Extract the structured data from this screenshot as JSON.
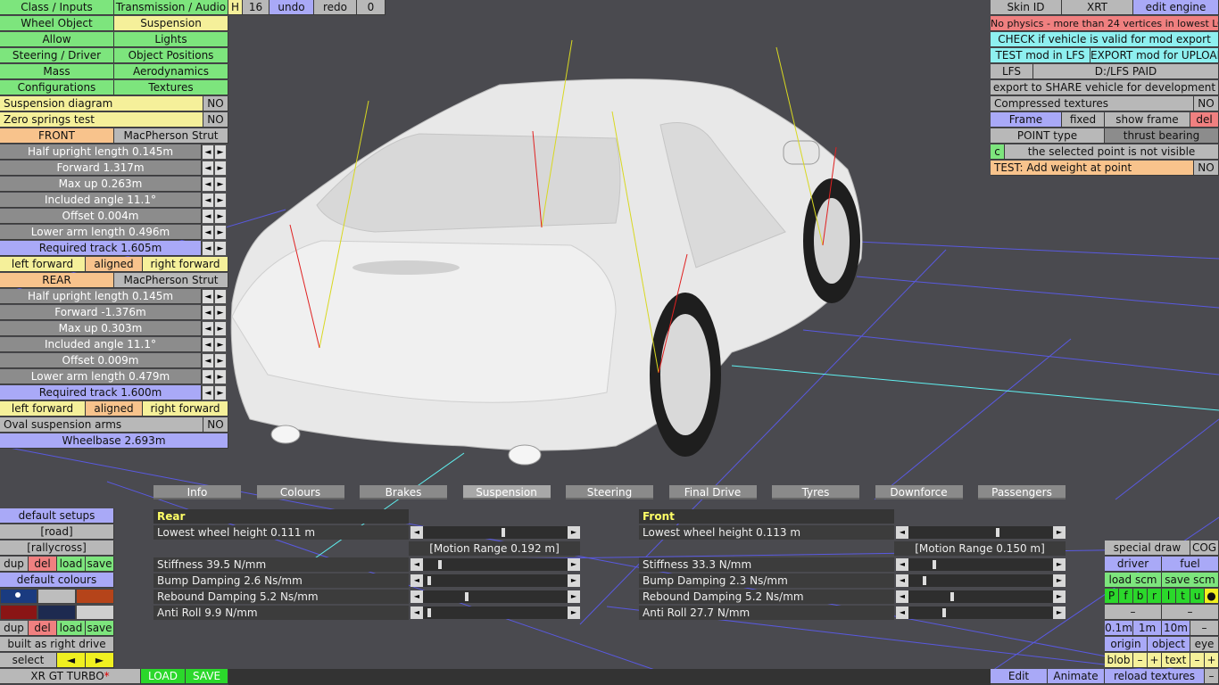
{
  "colors": {
    "green": "#7de57d",
    "yellow": "#f5f09a",
    "orange": "#f8c38c",
    "purple": "#a9a9f7",
    "cyan": "#8ef0f0",
    "red": "#f08080"
  },
  "left": {
    "class_inputs": "Class / Inputs",
    "transmission_audio": "Transmission / Audio",
    "h": "H",
    "num16": "16",
    "undo": "undo",
    "redo": "redo",
    "zero": "0",
    "wheel_object": "Wheel Object",
    "suspension": "Suspension",
    "allow": "Allow",
    "lights": "Lights",
    "steering_driver": "Steering / Driver",
    "object_positions": "Object Positions",
    "mass": "Mass",
    "aerodynamics": "Aerodynamics",
    "configurations": "Configurations",
    "textures": "Textures",
    "susp_diagram": "Suspension diagram",
    "zero_springs": "Zero springs test",
    "no": "NO",
    "front": "FRONT",
    "front_type": "MacPherson Strut",
    "front_params": [
      "Half upright length 0.145m",
      "Forward 1.317m",
      "Max up 0.263m",
      "Included angle 11.1°",
      "Offset 0.004m",
      "Lower arm length 0.496m"
    ],
    "front_track": "Required track 1.605m",
    "left_forward": "left forward",
    "aligned": "aligned",
    "right_forward": "right forward",
    "rear": "REAR",
    "rear_type": "MacPherson Strut",
    "rear_params": [
      "Half upright length 0.145m",
      "Forward -1.376m",
      "Max up 0.303m",
      "Included angle 11.1°",
      "Offset 0.009m",
      "Lower arm length 0.479m"
    ],
    "rear_track": "Required track 1.600m",
    "oval_arms": "Oval suspension arms",
    "wheelbase": "Wheelbase 2.693m"
  },
  "bottom_left": {
    "default_setups": "default setups",
    "road": "[road]",
    "rallycross": "[rallycross]",
    "dup": "dup",
    "del": "del",
    "load": "load",
    "save": "save",
    "default_colours": "default colours",
    "built_right": "built as right drive",
    "select": "select",
    "arrow_left": "◄",
    "arrow_right": "►",
    "car_name": "XR GT TURBO",
    "asterisk": "*",
    "load_btn": "LOAD",
    "save_btn": "SAVE",
    "swatch_colors": [
      "#1a3b80",
      "#bdbdbd",
      "#b5441a",
      "#8a1515",
      "#1d2a50",
      "#cfcfcf"
    ]
  },
  "right": {
    "skin_id": "Skin ID",
    "xrt": "XRT",
    "edit_engine": "edit engine",
    "warning": "No physics - more than 24 vertices in lowest LOD",
    "check_valid": "CHECK if vehicle is valid for mod export",
    "test_mod": "TEST mod in LFS",
    "export_mod": "EXPORT mod for UPLOAD",
    "lfs": "LFS",
    "path": "D:/LFS PAID",
    "export_share": "export to SHARE vehicle for development",
    "compressed": "Compressed textures",
    "no": "NO",
    "frame": "Frame",
    "fixed": "fixed",
    "show_frame": "show frame",
    "del": "del",
    "point_type": "POINT type",
    "thrust_bearing": "thrust bearing",
    "c": "c",
    "not_visible": "the selected point is not visible",
    "add_weight": "TEST: Add weight at point"
  },
  "tabs": [
    "Info",
    "Colours",
    "Brakes",
    "Suspension",
    "Steering",
    "Final Drive",
    "Tyres",
    "Downforce",
    "Passengers"
  ],
  "active_tab": "Suspension",
  "setup": {
    "rear": {
      "title": "Rear",
      "rows": [
        {
          "label": "Lowest wheel height 0.111 m",
          "pos": 0.56
        },
        {
          "label": "[Motion Range 0.192 m]"
        },
        {
          "label": "Stiffness 39.5 N/mm",
          "pos": 0.11
        },
        {
          "label": "Bump Damping 2.6 Ns/mm",
          "pos": 0.03
        },
        {
          "label": "Rebound Damping 5.2 Ns/mm",
          "pos": 0.3
        },
        {
          "label": "Anti Roll 9.9 N/mm",
          "pos": 0.03
        }
      ]
    },
    "front": {
      "title": "Front",
      "rows": [
        {
          "label": "Lowest wheel height 0.113 m",
          "pos": 0.62
        },
        {
          "label": "[Motion Range 0.150 m]"
        },
        {
          "label": "Stiffness 33.3 N/mm",
          "pos": 0.17
        },
        {
          "label": "Bump Damping 2.3 Ns/mm",
          "pos": 0.1
        },
        {
          "label": "Rebound Damping 5.2 Ns/mm",
          "pos": 0.3
        },
        {
          "label": "Anti Roll 27.7 N/mm",
          "pos": 0.24
        }
      ]
    }
  },
  "bottom_right": {
    "special_draw": "special draw",
    "cog": "COG",
    "driver": "driver",
    "fuel": "fuel",
    "load_scm": "load scm",
    "save_scm": "save scm",
    "letters": [
      "P",
      "f",
      "b",
      "r",
      "l",
      "t",
      "u",
      "●"
    ],
    "minus": "–",
    "d01": "0.1m",
    "d1": "1m",
    "d10": "10m",
    "origin": "origin",
    "object": "object",
    "eye": "eye",
    "blob": "blob",
    "text": "text",
    "plus": "+",
    "edit": "Edit",
    "animate": "Animate",
    "reload": "reload textures"
  }
}
